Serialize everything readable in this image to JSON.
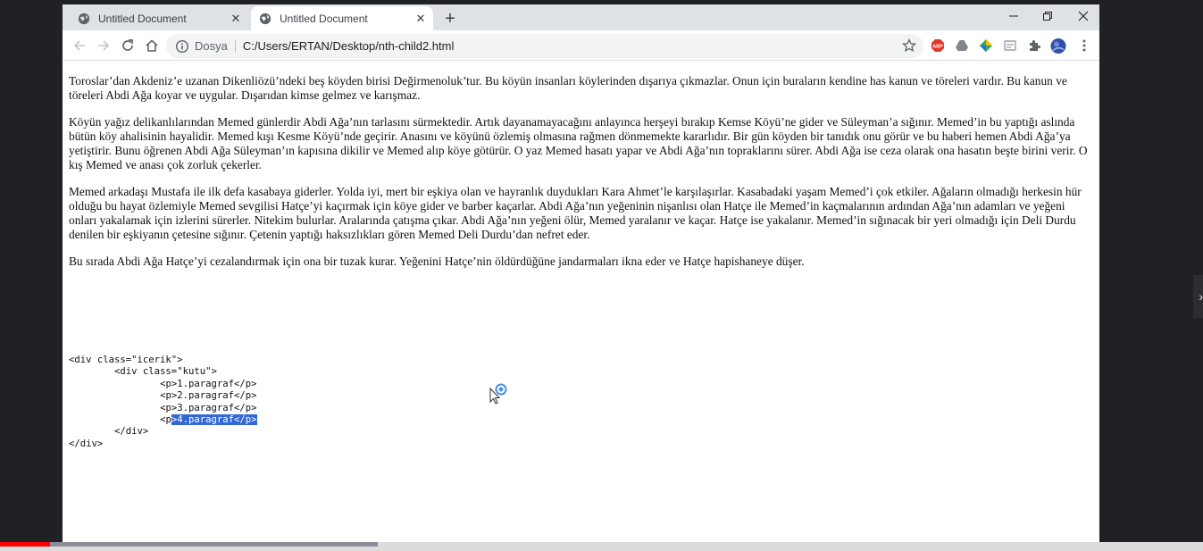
{
  "tabs": [
    {
      "title": "Untitled Document",
      "close": "✕"
    },
    {
      "title": "Untitled Document",
      "close": "✕"
    }
  ],
  "new_tab_label": "+",
  "window_controls": {
    "minimize": "—",
    "maximize": "❐",
    "close": "✕"
  },
  "address_bar": {
    "security_label": "Dosya",
    "url": "C:/Users/ERTAN/Desktop/nth-child2.html"
  },
  "extensions": [
    "adblock-plus-icon",
    "drive-icon",
    "google-earth-icon",
    "cast-icon",
    "puzzle-icon",
    "profile-avatar",
    "menu-icon"
  ],
  "content": {
    "paragraphs": [
      "Toroslar’dan Akdeniz’e uzanan Dikenliözü’ndeki beş köyden birisi Değirmenoluk’tur. Bu köyün insanları köylerinden dışarıya çıkmazlar. Onun için buraların kendine has kanun ve töreleri vardır. Bu kanun ve töreleri Abdi Ağa koyar ve uygular. Dışarıdan kimse gelmez ve karışmaz.",
      "Köyün yağız delikanlılarından Memed günlerdir Abdi Ağa’nın tarlasını sürmektedir. Artık dayanamayacağını anlayınca herşeyi bırakıp Kemse Köyü’ne gider ve Süleyman’a sığınır. Memed’in bu yaptığı aslında bütün köy ahalisinin hayalidir. Memed kışı Kesme Köyü’nde geçirir. Anasını ve köyünü özlemiş olmasına rağmen dönmemekte kararlıdır. Bir gün köyden bir tanıdık onu görür ve bu haberi hemen Abdi Ağa’ya yetiştirir. Bunu öğrenen Abdi Ağa Süleyman’ın kapısına dikilir ve Memed alıp köye götürür. O yaz Memed hasatı yapar ve Abdi Ağa’nın topraklarını sürer. Abdi Ağa ise ceza olarak ona hasatın beşte birini verir. O kış Memed ve anası çok zorluk çekerler.",
      "Memed arkadaşı Mustafa ile ilk defa kasabaya giderler. Yolda iyi, mert bir eşkiya olan ve hayranlık duydukları Kara Ahmet’le karşılaşırlar. Kasabadaki yaşam Memed’i çok etkiler. Ağaların olmadığı herkesin hür olduğu bu hayat özlemiyle Memed sevgilisi Hatçe’yi kaçırmak için köye gider ve barber kaçarlar. Abdi Ağa’nın yeğeninin nişanlısı olan Hatçe ile Memed’in kaçmalarının ardından Ağa’nın adamları ve yeğeni onları yakalamak için izlerini sürerler. Nitekim bulurlar. Aralarında çatışma çıkar. Abdi Ağa’nın yeğeni ölür, Memed yaralanır ve kaçar. Hatçe ise yakalanır. Memed’in sığınacak bir yeri olmadığı için Deli Durdu denilen bir eşkiyanın çetesine sığınır. Çetenin yaptığı haksızlıkları gören Memed Deli Durdu’dan nefret eder.",
      "Bu sırada Abdi Ağa Hatçe’yi cezalandırmak için ona bir tuzak kurar. Yeğenini Hatçe’nin öldürdüğüne jandarmaları ikna eder ve Hatçe hapishaneye düşer."
    ],
    "code_lines": [
      {
        "plain": "<div class=\"icerik\">",
        "selected": ""
      },
      {
        "plain": "\t<div class=\"kutu\">",
        "selected": ""
      },
      {
        "plain": "\t\t<p>1.paragraf</p>",
        "selected": ""
      },
      {
        "plain": "\t\t<p>2.paragraf</p>",
        "selected": ""
      },
      {
        "plain": "\t\t<p>3.paragraf</p>",
        "selected": ""
      },
      {
        "plain": "\t\t<p",
        "selected": ">4.paragraf</p>"
      },
      {
        "plain": "\t</div>",
        "selected": ""
      },
      {
        "plain": "</div>",
        "selected": ""
      }
    ]
  },
  "video_progress": {
    "played_fraction": 0.042,
    "buffered_fraction": 0.314
  },
  "colors": {
    "selection": "#3367d6",
    "progress_played": "#ff0000",
    "progress_buffered": "#8d8d9a"
  }
}
